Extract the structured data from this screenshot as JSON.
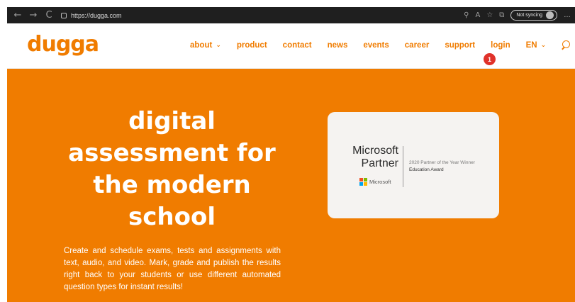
{
  "browser": {
    "url": "https://dugga.com",
    "sync_label": "Not syncing",
    "back_glyph": "←",
    "forward_glyph": "→",
    "reload_glyph": "C"
  },
  "site": {
    "logo": "dugga",
    "nav": [
      {
        "label": "about",
        "dropdown": true
      },
      {
        "label": "product",
        "dropdown": false
      },
      {
        "label": "contact",
        "dropdown": false
      },
      {
        "label": "news",
        "dropdown": false
      },
      {
        "label": "events",
        "dropdown": false
      },
      {
        "label": "career",
        "dropdown": false
      },
      {
        "label": "support",
        "dropdown": false
      },
      {
        "label": "login",
        "dropdown": false
      },
      {
        "label": "EN",
        "dropdown": true
      }
    ],
    "marker_label": "1"
  },
  "hero": {
    "title_lines": [
      "digital",
      "assessment for",
      "the modern",
      "school"
    ],
    "description": "Create and schedule exams, tests and assignments with text, audio, and video.  Mark, grade and publish the results right back to your students or use different automated question types for instant results!"
  },
  "badge": {
    "line1": "Microsoft",
    "line2": "Partner",
    "small_logo_text": "Microsoft",
    "award": "2020 Partner of the Year Winner",
    "award_category": "Education Award",
    "logo_colors": [
      "#f25022",
      "#7fba00",
      "#00a4ef",
      "#ffb900"
    ]
  },
  "colors": {
    "brand": "#f07c00",
    "marker": "#e0322a"
  }
}
